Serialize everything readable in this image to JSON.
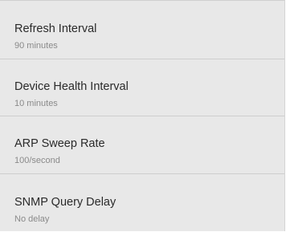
{
  "settings": [
    {
      "title": "Refresh Interval",
      "value": "90 minutes"
    },
    {
      "title": "Device Health Interval",
      "value": "10 minutes"
    },
    {
      "title": "ARP Sweep Rate",
      "value": "100/second"
    },
    {
      "title": "SNMP Query Delay",
      "value": "No delay"
    }
  ]
}
